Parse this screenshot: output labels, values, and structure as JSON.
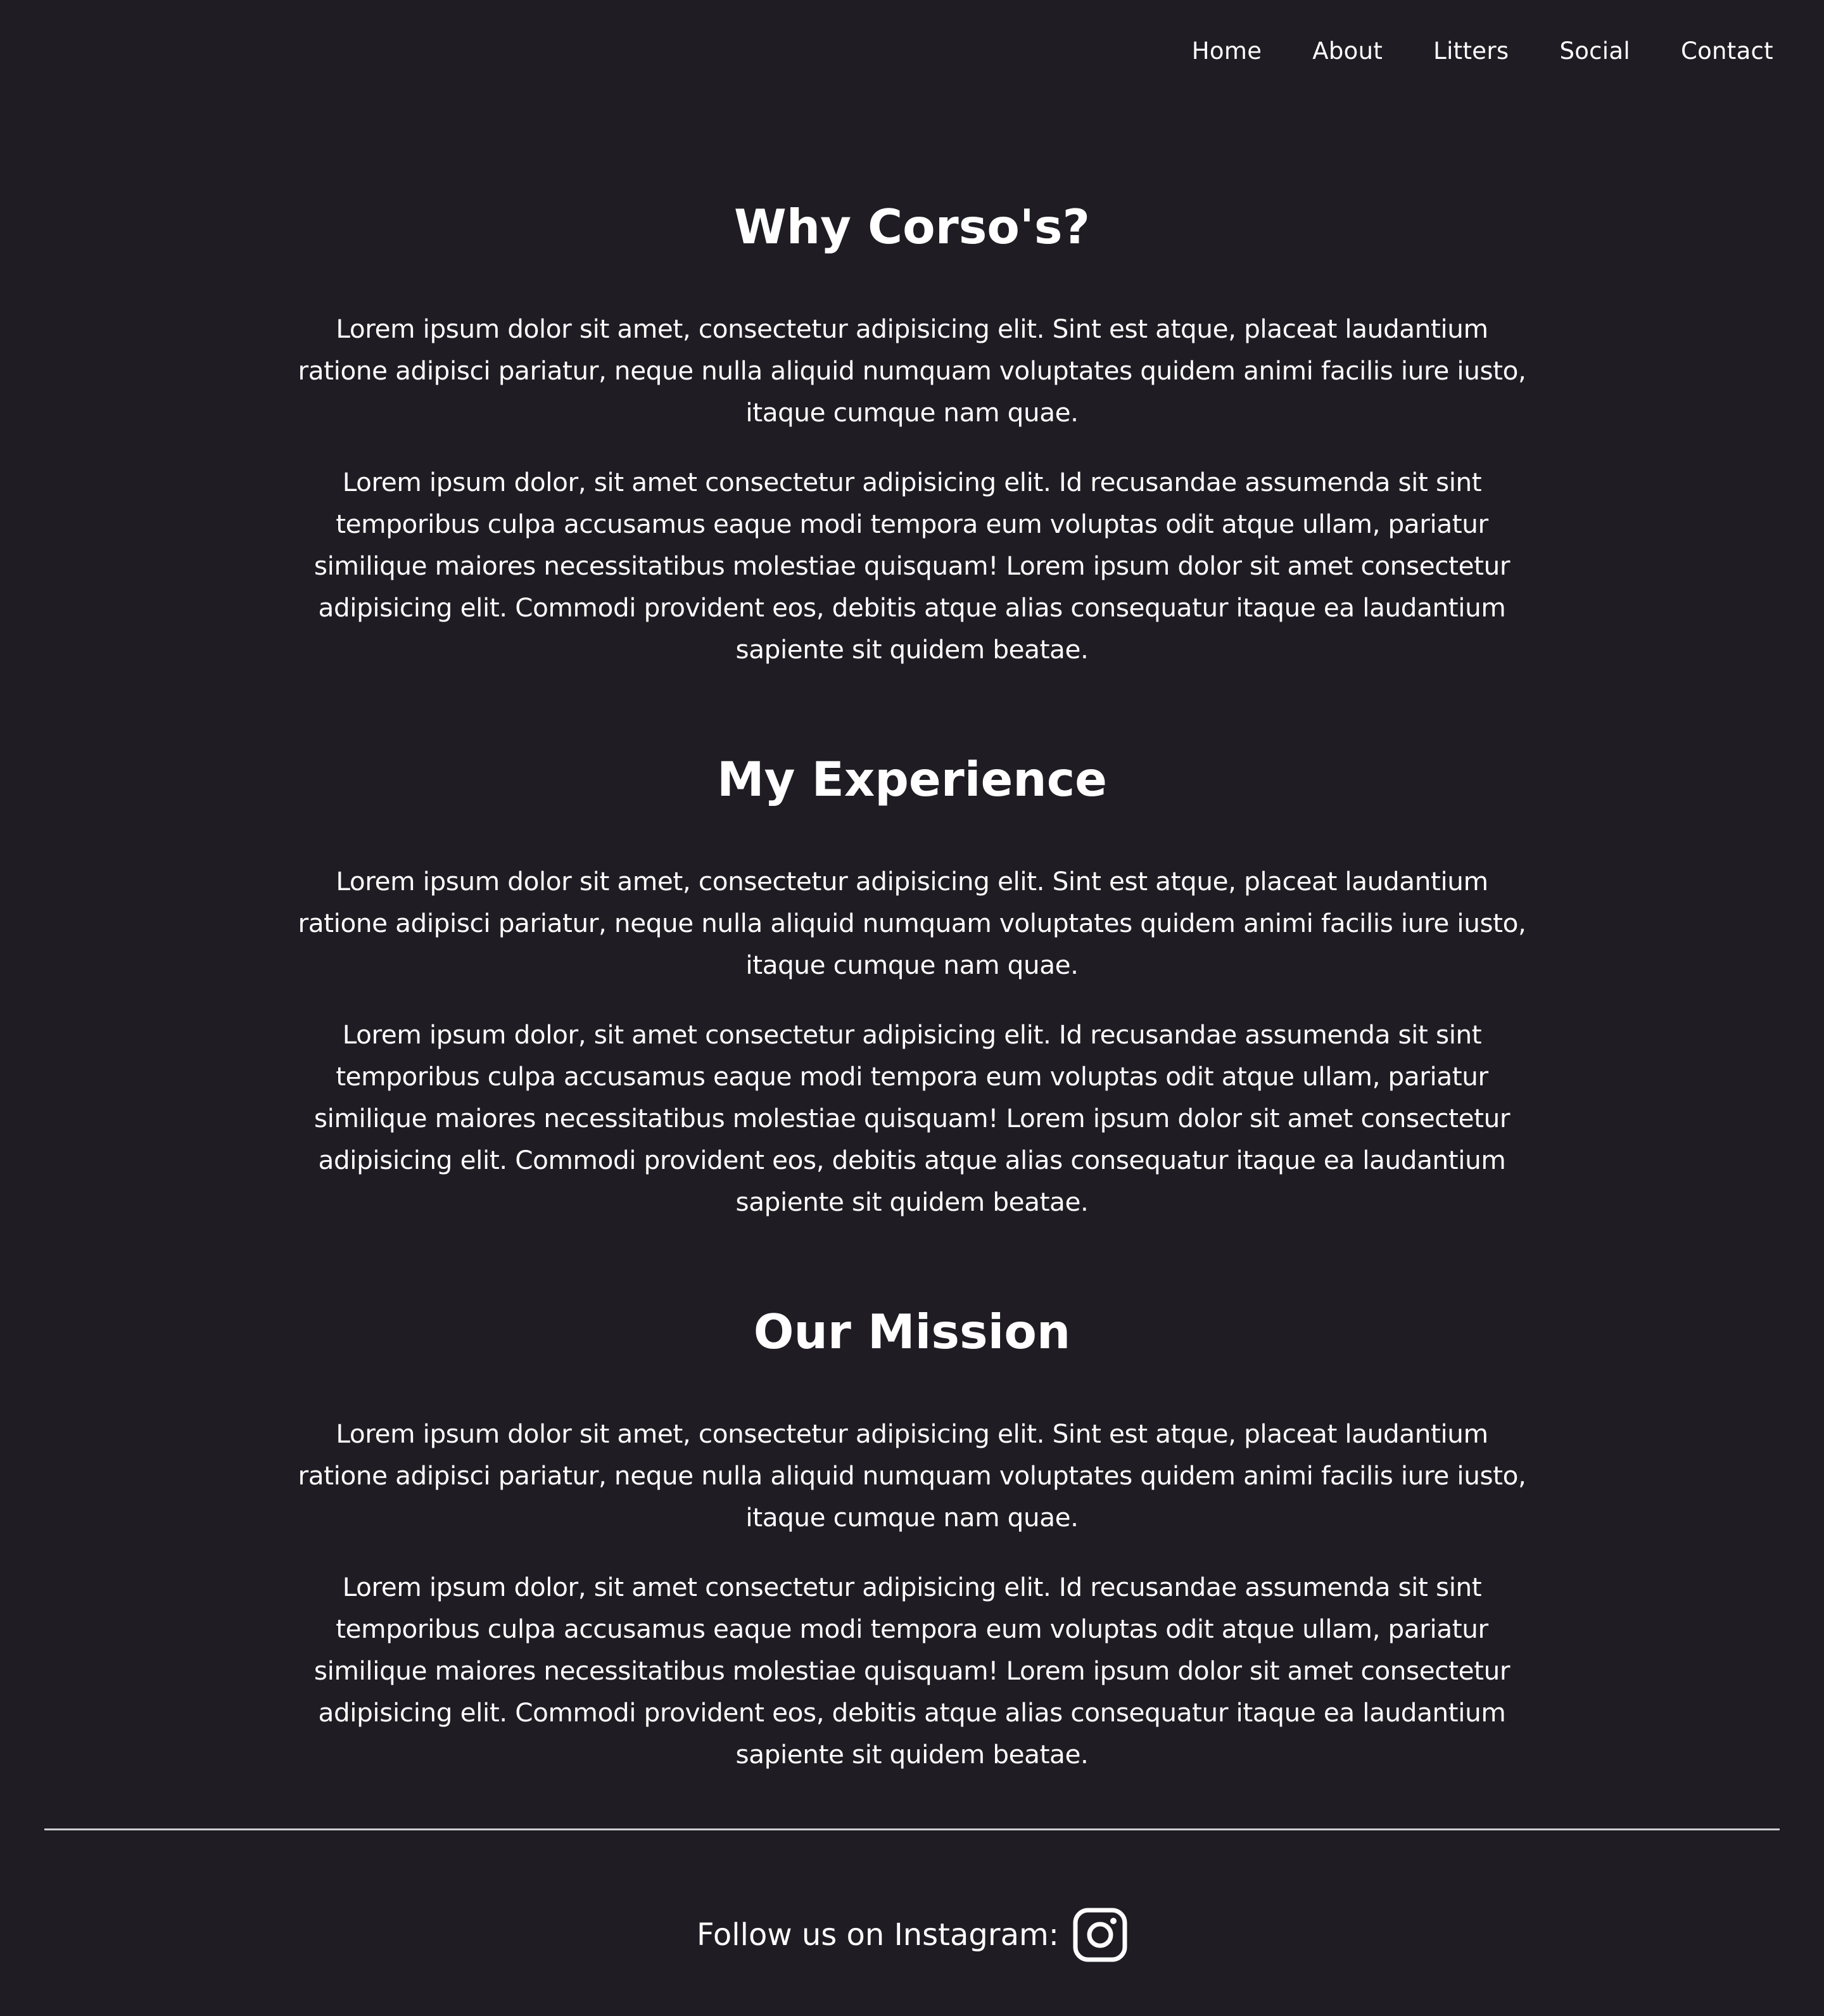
{
  "nav": {
    "items": [
      {
        "label": "Home"
      },
      {
        "label": "About"
      },
      {
        "label": "Litters"
      },
      {
        "label": "Social"
      },
      {
        "label": "Contact"
      }
    ]
  },
  "sections": [
    {
      "title": "Why Corso's?",
      "paragraphs": [
        "Lorem ipsum dolor sit amet, consectetur adipisicing elit. Sint est atque, placeat laudantium ratione adipisci pariatur, neque nulla aliquid numquam voluptates quidem animi facilis iure iusto, itaque cumque nam quae.",
        "Lorem ipsum dolor, sit amet consectetur adipisicing elit. Id recusandae assumenda sit sint temporibus culpa accusamus eaque modi tempora eum voluptas odit atque ullam, pariatur similique maiores necessitatibus molestiae quisquam! Lorem ipsum dolor sit amet consectetur adipisicing elit. Commodi provident eos, debitis atque alias consequatur itaque ea laudantium sapiente sit quidem beatae."
      ]
    },
    {
      "title": "My Experience",
      "paragraphs": [
        "Lorem ipsum dolor sit amet, consectetur adipisicing elit. Sint est atque, placeat laudantium ratione adipisci pariatur, neque nulla aliquid numquam voluptates quidem animi facilis iure iusto, itaque cumque nam quae.",
        "Lorem ipsum dolor, sit amet consectetur adipisicing elit. Id recusandae assumenda sit sint temporibus culpa accusamus eaque modi tempora eum voluptas odit atque ullam, pariatur similique maiores necessitatibus molestiae quisquam! Lorem ipsum dolor sit amet consectetur adipisicing elit. Commodi provident eos, debitis atque alias consequatur itaque ea laudantium sapiente sit quidem beatae."
      ]
    },
    {
      "title": "Our Mission",
      "paragraphs": [
        "Lorem ipsum dolor sit amet, consectetur adipisicing elit. Sint est atque, placeat laudantium ratione adipisci pariatur, neque nulla aliquid numquam voluptates quidem animi facilis iure iusto, itaque cumque nam quae.",
        "Lorem ipsum dolor, sit amet consectetur adipisicing elit. Id recusandae assumenda sit sint temporibus culpa accusamus eaque modi tempora eum voluptas odit atque ullam, pariatur similique maiores necessitatibus molestiae quisquam! Lorem ipsum dolor sit amet consectetur adipisicing elit. Commodi provident eos, debitis atque alias consequatur itaque ea laudantium sapiente sit quidem beatae."
      ]
    }
  ],
  "footer": {
    "text": "Follow us on Instagram:",
    "icon": "instagram-icon"
  },
  "colors": {
    "background": "#1f1d23",
    "text": "#ffffff",
    "divider": "#cfcfd2"
  }
}
